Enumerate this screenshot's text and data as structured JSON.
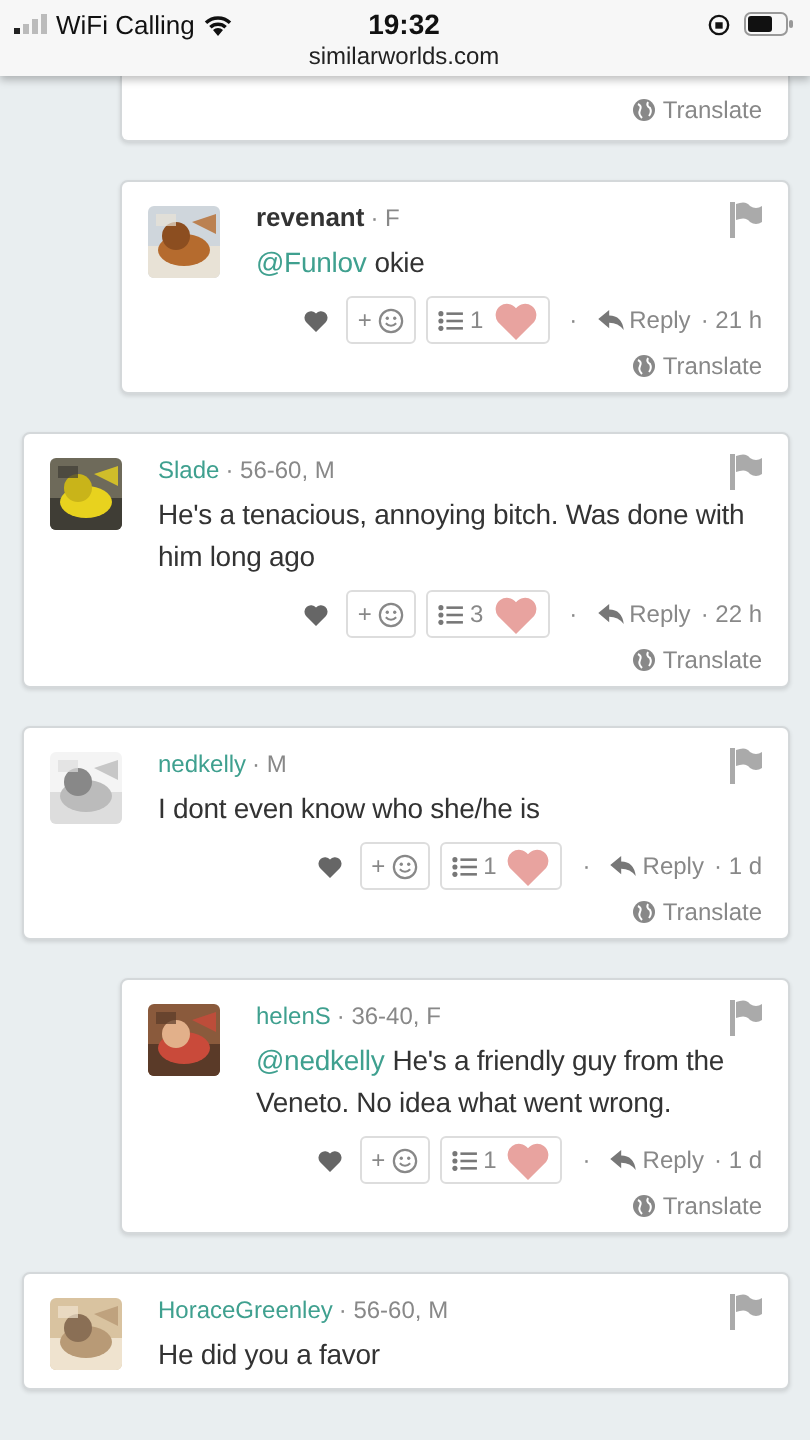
{
  "status_bar": {
    "carrier": "WiFi Calling",
    "time": "19:32",
    "url": "similarworlds.com"
  },
  "comments": [
    {
      "kind": "partial",
      "is_reply": true,
      "translate": "Translate"
    },
    {
      "kind": "full",
      "is_reply": true,
      "author": "revenant",
      "author_bold": true,
      "meta": "· F",
      "mention": "@Funlov",
      "text": "okie",
      "add_label": "+",
      "reaction_count": "1",
      "lead_dot": "·",
      "reply_label": "Reply",
      "age": "· 21 h",
      "translate": "Translate"
    },
    {
      "kind": "full",
      "is_reply": false,
      "author": "Slade",
      "author_bold": false,
      "meta": "· 56-60, M",
      "text": "He's a tenacious, annoying bitch. Was done with him long ago",
      "add_label": "+",
      "reaction_count": "3",
      "lead_dot": "·",
      "reply_label": "Reply",
      "age": "· 22 h",
      "translate": "Translate"
    },
    {
      "kind": "full",
      "is_reply": false,
      "author": "nedkelly",
      "author_bold": false,
      "meta": "· M",
      "text": "I dont even know who she/he is",
      "add_label": "+",
      "reaction_count": "1",
      "lead_dot": "·",
      "reply_label": "Reply",
      "age": "· 1 d",
      "translate": "Translate"
    },
    {
      "kind": "full",
      "is_reply": true,
      "author": "helenS",
      "author_bold": false,
      "meta": "· 36-40, F",
      "mention": "@nedkelly",
      "text": "He's a friendly guy from the Veneto. No idea what went wrong.",
      "add_label": "+",
      "reaction_count": "1",
      "lead_dot": "·",
      "reply_label": "Reply",
      "age": "· 1 d",
      "translate": "Translate"
    },
    {
      "kind": "cut",
      "is_reply": false,
      "author": "HoraceGreenley",
      "author_bold": false,
      "meta": "· 56-60, M",
      "text": "He did you a favor"
    }
  ]
}
